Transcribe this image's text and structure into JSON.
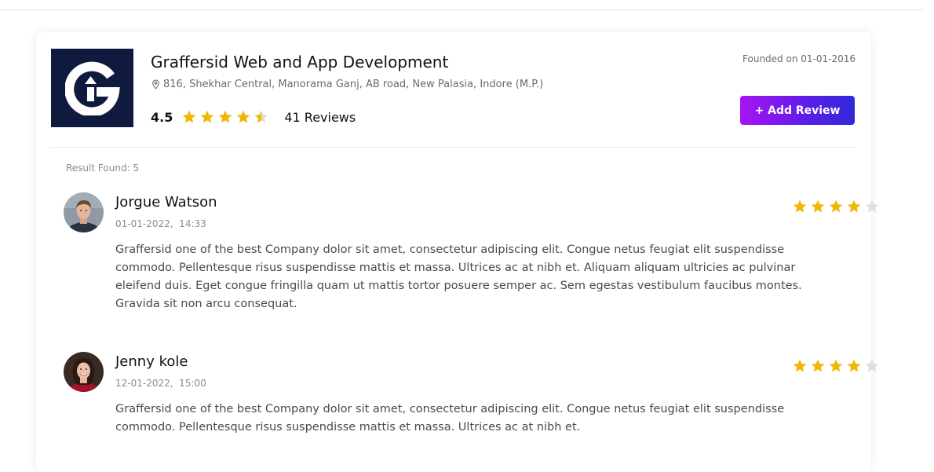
{
  "company": {
    "name": "Graffersid Web and App Development",
    "address": "816, Shekhar Central, Manorama Ganj, AB road, New Palasia, Indore (M.P.)",
    "rating": "4.5",
    "rating_value": 4.5,
    "review_count": "41 Reviews",
    "founded": "Founded on 01-01-2016",
    "logo_icon": "graffersid-logo-icon",
    "logo_background": "#0f1a3e"
  },
  "actions": {
    "add_review_label": "+ Add Review",
    "accent_gradient": [
      "#a713f2",
      "#2f2ad8"
    ]
  },
  "results": {
    "label": "Result Found: 5"
  },
  "reviews": [
    {
      "name": "Jorgue Watson",
      "date": "01-01-2022,  14:33",
      "rating": 4,
      "text": "Graffersid one of the best Company dolor sit amet, consectetur adipiscing elit. Congue netus feugiat elit suspendisse commodo. Pellentesque risus suspendisse mattis et massa. Ultrices ac at nibh et. Aliquam aliquam ultricies ac pulvinar eleifend duis. Eget congue fringilla quam ut mattis tortor posuere semper ac. Sem egestas vestibulum faucibus montes. Gravida sit non arcu consequat."
    },
    {
      "name": "Jenny kole",
      "date": "12-01-2022,  15:00",
      "rating": 4,
      "text": "Graffersid one of the best Company dolor sit amet, consectetur adipiscing elit. Congue netus feugiat elit suspendisse commodo. Pellentesque risus suspendisse mattis et massa. Ultrices ac at nibh et."
    }
  ],
  "colors": {
    "star_filled": "#f2b705",
    "star_empty": "#dedede"
  }
}
